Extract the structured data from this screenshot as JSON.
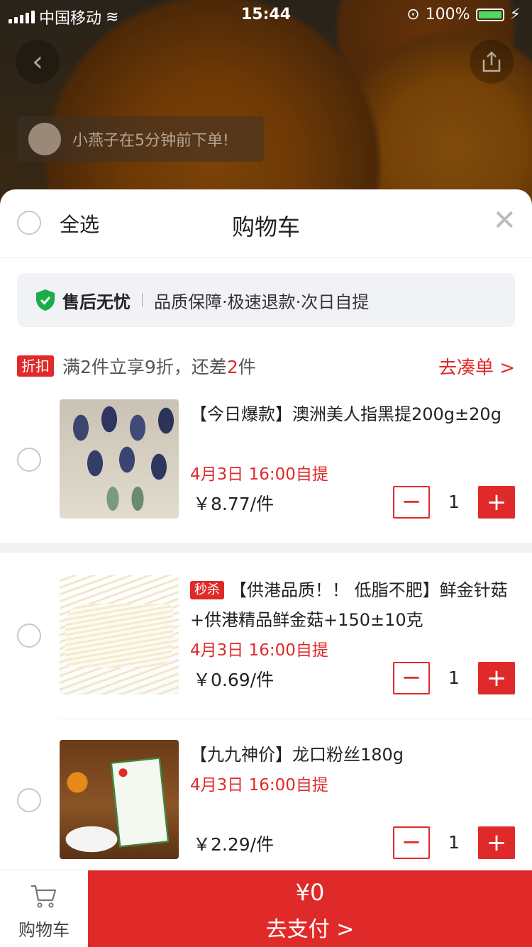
{
  "status_bar": {
    "carrier": "中国移动",
    "time": "15:44",
    "battery": "100%"
  },
  "background": {
    "toast": "小燕子在5分钟前下单!"
  },
  "header": {
    "select_all": "全选",
    "title": "购物车"
  },
  "guarantee": {
    "title": "售后无忧",
    "desc": "品质保障·极速退款·次日自提"
  },
  "promo": {
    "badge": "折扣",
    "text_prefix": "满2件立享9折，还差",
    "text_count": "2",
    "text_suffix": "件",
    "link": "去凑单 >"
  },
  "items": [
    {
      "title": "【今日爆款】澳洲美人指黑提200g±20g",
      "pickup": "4月3日 16:00自提",
      "price": "￥8.77/件",
      "qty": "1"
    },
    {
      "badge": "秒杀",
      "title": "【供港品质！！ 低脂不肥】鲜金针菇+供港精品鲜金菇+150±10克",
      "pickup": "4月3日 16:00自提",
      "price": "￥0.69/件",
      "qty": "1"
    },
    {
      "title": "【九九神价】龙口粉丝180g",
      "pickup": "4月3日 16:00自提",
      "price": "￥2.29/件",
      "qty": "1"
    }
  ],
  "bottom_bar": {
    "cart_label": "购物车",
    "pay_amount": "¥0",
    "pay_label": "去支付 >"
  },
  "colors": {
    "accent": "#e02a2a",
    "shield": "#1aad4c"
  }
}
